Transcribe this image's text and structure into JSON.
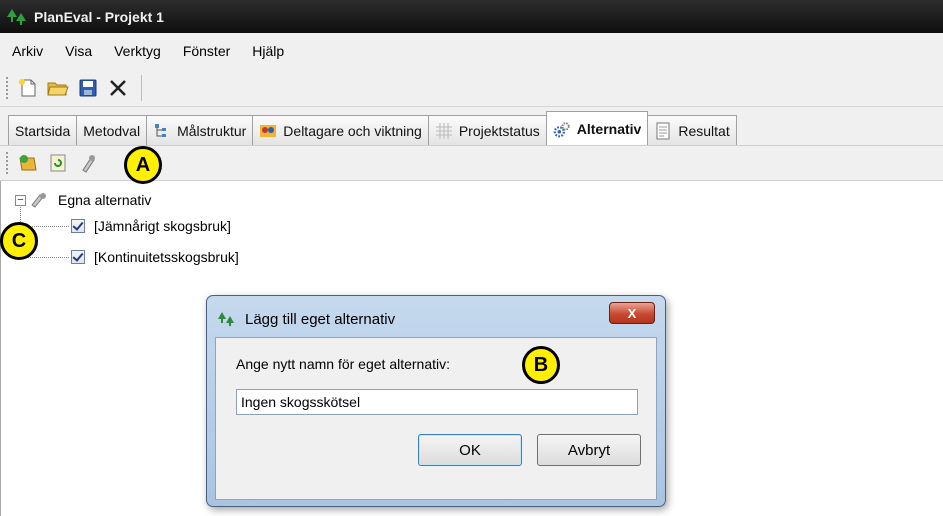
{
  "window": {
    "title": "PlanEval - Projekt 1"
  },
  "menu": [
    "Arkiv",
    "Visa",
    "Verktyg",
    "Fönster",
    "Hjälp"
  ],
  "toolbar": {
    "icons": [
      "new-icon",
      "open-folder-icon",
      "save-icon",
      "delete-icon"
    ]
  },
  "tabs": [
    {
      "label": "Startsida",
      "icon": ""
    },
    {
      "label": "Metodval",
      "icon": ""
    },
    {
      "label": "Målstruktur",
      "icon": "hierarchy-icon"
    },
    {
      "label": "Deltagare och viktning",
      "icon": "participants-icon"
    },
    {
      "label": "Projektstatus",
      "icon": "grid-icon"
    },
    {
      "label": "Alternativ",
      "icon": "gears-icon",
      "active": true
    },
    {
      "label": "Resultat",
      "icon": "report-icon"
    }
  ],
  "subtoolbar": {
    "icons": [
      "add-alternative-icon",
      "refresh-alternative-icon",
      "remove-alternative-icon"
    ]
  },
  "tree": {
    "root_label": "Egna alternativ",
    "items": [
      {
        "label": "[Jämnårigt skogsbruk]",
        "checked": true
      },
      {
        "label": "[Kontinuitetsskogsbruk]",
        "checked": true
      }
    ]
  },
  "dialog": {
    "title": "Lägg till eget alternativ",
    "close_label": "X",
    "prompt": "Ange nytt namn för eget alternativ:",
    "input_value": "Ingen skogsskötsel",
    "ok_label": "OK",
    "cancel_label": "Avbryt"
  },
  "markers": {
    "a": "A",
    "b": "B",
    "c": "C"
  },
  "colors": {
    "marker": "#ffef00",
    "titlebar": "#1a1a1a",
    "close_button": "#c84a32"
  }
}
